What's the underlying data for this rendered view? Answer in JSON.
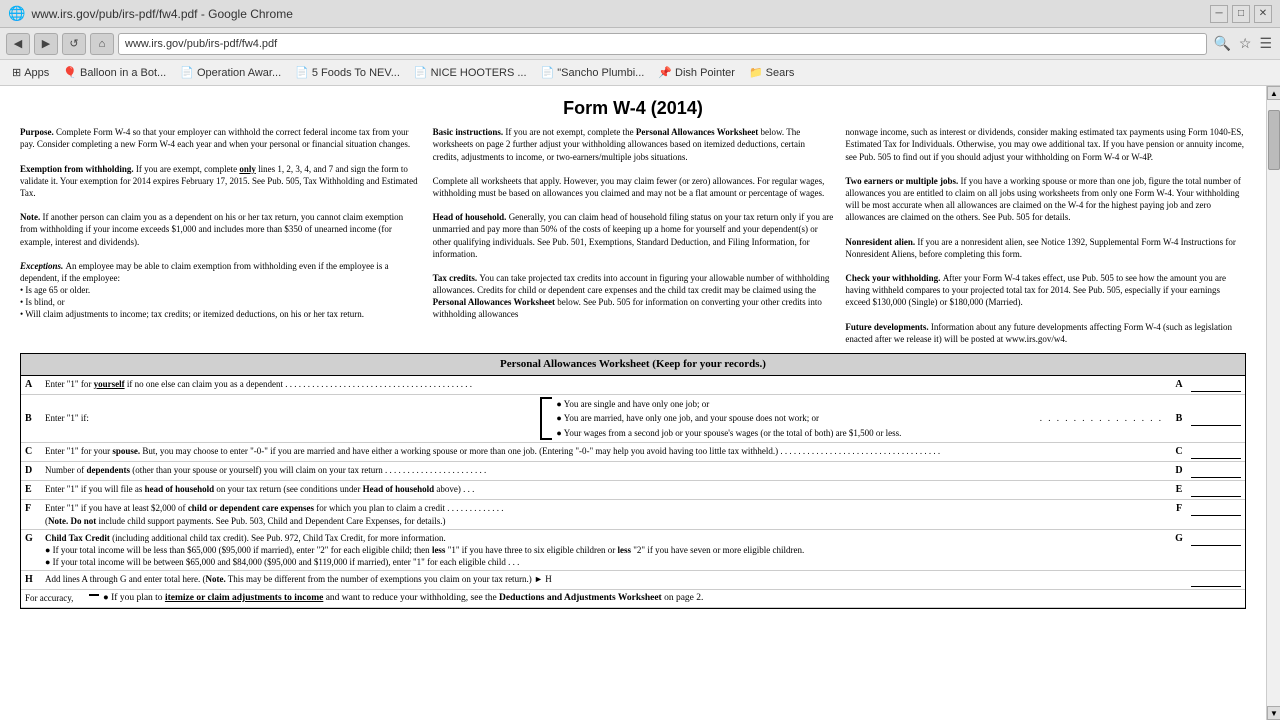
{
  "browser": {
    "title": "www.irs.gov/pub/irs-pdf/fw4.pdf - Google Chrome",
    "address": "www.irs.gov/pub/irs-pdf/fw4.pdf",
    "window_controls": [
      "minimize",
      "maximize",
      "close"
    ]
  },
  "bookmarks": [
    {
      "icon": "🔲",
      "label": "Apps"
    },
    {
      "icon": "🎈",
      "label": "Balloon in a Bot..."
    },
    {
      "icon": "📄",
      "label": "Operation Awar..."
    },
    {
      "icon": "🥦",
      "label": "5 Foods To NEV..."
    },
    {
      "icon": "📄",
      "label": "NICE HOOTERS ..."
    },
    {
      "icon": "📄",
      "label": "\"Sancho Plumbi..."
    },
    {
      "icon": "📌",
      "label": "Dish Pointer"
    },
    {
      "icon": "📁",
      "label": "Sears"
    }
  ],
  "pdf": {
    "form_title": "Form W-4 (2014)",
    "cols": {
      "col1": {
        "purpose_heading": "Purpose.",
        "purpose_text": "Complete Form W-4 so that your employer can withhold the correct federal income tax from your pay. Consider completing a new Form W-4 each year and when your personal or financial situation changes.",
        "exemption_heading": "Exemption from withholding.",
        "exemption_text": "If you are exempt, complete only lines 1, 2, 3, 4, and 7 and sign the form to validate it. Your exemption for 2014 expires February 17, 2015. See Pub. 505, Tax Withholding and Estimated Tax.",
        "note_heading": "Note.",
        "note_text": "If another person can claim you as a dependent on his or her tax return, you cannot claim exemption from withholding if your income exceeds $1,000 and includes more than $350 of unearned income (for example, interest and dividends).",
        "exceptions_heading": "Exceptions.",
        "exceptions_text": "An employee may be able to claim exemption from withholding even if the employee is a dependent, if the employee:",
        "bullet1": "• Is age 65 or older.",
        "bullet2": "• Is blind, or",
        "bullet3": "• Will claim adjustments to income; tax credits; or itemized deductions, on his or her tax return."
      },
      "col2": {
        "basic_heading": "Basic instructions.",
        "basic_text": "If you are not exempt, complete the Personal Allowances Worksheet below. The worksheets on page 2 further adjust your withholding allowances based on itemized deductions, certain credits, adjustments to income, or two-earners/multiple jobs situations.",
        "complete_text": "Complete all worksheets that apply. However, you may claim fewer (or zero) allowances. For regular wages, withholding must be based on allowances you claimed and may not be a flat amount or percentage of wages.",
        "hoh_heading": "Head of household.",
        "hoh_text": "Generally, you can claim head of household filing status on your tax return only if you are unmarried and pay more than 50% of the costs of keeping up a home for yourself and your dependent(s) or other qualifying individuals. See Pub. 501, Exemptions, Standard Deduction, and Filing Information, for information.",
        "tax_credits_heading": "Tax credits.",
        "tax_credits_text": "You can take projected tax credits into account in figuring your allowable number of withholding allowances. Credits for child or dependent care expenses and the child tax credit may be claimed using the Personal Allowances Worksheet below. See Pub. 505 for information on converting your other credits into withholding allowances"
      },
      "col3": {
        "nonwage_text": "nonwage income, such as interest or dividends, consider making estimated tax payments using Form 1040-ES, Estimated Tax for Individuals. Otherwise, you may owe additional tax. If you have pension or annuity income, see Pub. 505 to find out if you should adjust your withholding on Form W-4 or W-4P.",
        "two_earners_heading": "Two earners or multiple jobs.",
        "two_earners_text": "If you have a working spouse or more than one job, figure the total number of allowances you are entitled to claim on all jobs using worksheets from only one Form W-4. Your withholding will be most accurate when all allowances are claimed on the W-4 for the highest paying job and zero allowances are claimed on the others. See Pub. 505 for details.",
        "nonresident_heading": "Nonresident alien.",
        "nonresident_text": "If you are a nonresident alien, see Notice 1392, Supplemental Form W-4 Instructions for Nonresident Aliens, before completing this form.",
        "check_heading": "Check your withholding.",
        "check_text": "After your Form W-4 takes effect, use Pub. 505 to see how the amount you are having withheld compares to your projected total tax for 2014. See Pub. 505, especially if your earnings exceed $130,000 (Single) or $180,000 (Married).",
        "future_heading": "Future developments.",
        "future_text": "Information about any future developments affecting Form W-4 (such as legislation enacted after we release it) will be posted at www.irs.gov/w4."
      }
    },
    "worksheet": {
      "title": "Personal Allowances Worksheet",
      "subtitle": "(Keep for your records.)",
      "rows": [
        {
          "letter": "A",
          "content": "Enter \"1\" for yourself if no one else can claim you as a dependent",
          "dots": ". . . . . . . . . . . . . . . . . . . . . . . .",
          "end_letter": "A"
        },
        {
          "letter": "B",
          "content": "Enter \"1\" if:",
          "bullets": [
            "• You are single and have only one job; or",
            "• You are married, have only one job, and your spouse does not work; or",
            "• Your wages from a second job or your spouse's wages (or the total of both) are $1,500 or less."
          ],
          "dots": ". . . . . . . . . . . . . . .",
          "end_letter": "B"
        },
        {
          "letter": "C",
          "content": "Enter \"1\" for your spouse. But, you may choose to enter \"-0-\" if you are married and have either a working spouse or more than one job. (Entering \"-0-\" may help you avoid having too little tax withheld.)",
          "dots": ". . . . . . . . . . . . . . . . . . . . . . . . .",
          "end_letter": "C"
        },
        {
          "letter": "D",
          "content": "Number of dependents (other than your spouse or yourself) you will claim on your tax return",
          "dots": ". . . . . . . . . . . . . . .",
          "end_letter": "D"
        },
        {
          "letter": "E",
          "content": "Enter \"1\" if you will file as head of household on your tax return (see conditions under Head of household above)",
          "dots": ". . .",
          "end_letter": "E"
        },
        {
          "letter": "F",
          "content": "Enter \"1\" if you have at least $2,000 of child or dependent care expenses for which you plan to claim a credit (Note. Do not include child support payments. See Pub. 503, Child and Dependent Care Expenses, for details.)",
          "dots": ". . . . . . . . . . . . . .",
          "end_letter": "F"
        },
        {
          "letter": "G",
          "content_g1": "Child Tax Credit (including additional child tax credit). See Pub. 972, Child Tax Credit, for more information.",
          "content_g2": "• If your total income will be less than $65,000 ($95,000 if married), enter \"2\" for each eligible child; then less \"1\" if you have three to six eligible children or less \"2\" if you have seven or more eligible children.",
          "content_g3": "• If your total income will be between $65,000 and $84,000 ($95,000 and $119,000 if married), enter \"1\" for each eligible child",
          "dots": ". . .",
          "end_letter": "G"
        },
        {
          "letter": "H",
          "content": "Add lines A through G and enter total here. (Note. This may be different from the number of exemptions you claim on your tax return.) ► H",
          "end_letter": "H"
        }
      ],
      "accuracy_label": "For accuracy,",
      "accuracy_bullets": [
        "• If you plan to itemize or claim adjustments to income and want to reduce your withholding, see the Deductions and Adjustments Worksheet on page 2."
      ]
    }
  }
}
